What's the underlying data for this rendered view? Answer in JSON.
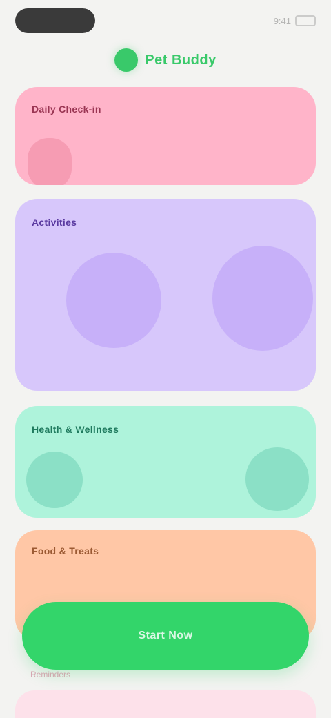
{
  "status_bar": {
    "time": "9:41",
    "signal_icon": "signal-icon",
    "battery_icon": "battery-icon"
  },
  "brand": {
    "icon": "brand-logo-icon",
    "name": "Pet Buddy"
  },
  "cards": {
    "pink_title": "Daily Check-in",
    "purple_title": "Activities",
    "mint_title": "Health & Wellness",
    "peach_title": "Food & Treats"
  },
  "action_button": {
    "label": "Start Now"
  },
  "bottom": {
    "label": "Reminders"
  },
  "colors": {
    "background": "#f3f3f1",
    "brand_green": "#39c96a",
    "pink_card": "#ffb4c9",
    "purple_card": "#d7c7fb",
    "mint_card": "#aef3db",
    "peach_card": "#ffc7a6",
    "button_green": "#33d56a"
  }
}
